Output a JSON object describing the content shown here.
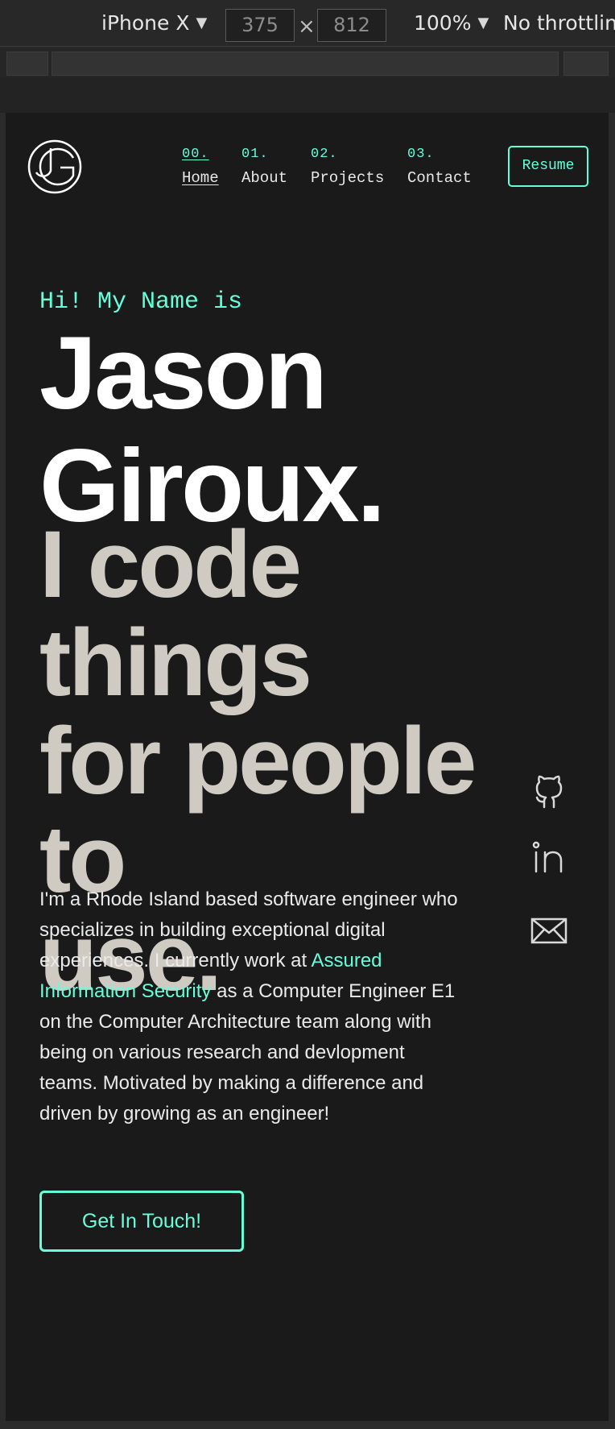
{
  "devtools": {
    "device": "iPhone X",
    "width": "375",
    "height": "812",
    "times": "×",
    "zoom": "100%",
    "throttling": "No throttling"
  },
  "header": {
    "nav": [
      {
        "num": "00.",
        "label": "Home"
      },
      {
        "num": "01.",
        "label": "About"
      },
      {
        "num": "02.",
        "label": "Projects"
      },
      {
        "num": "03.",
        "label": "Contact"
      }
    ],
    "resume": "Resume"
  },
  "hero": {
    "greeting": "Hi! My Name is",
    "name_line1": "Jason",
    "name_line2": "Giroux.",
    "tagline_line1": "I code things",
    "tagline_line2": "for people to",
    "tagline_line3": "use.",
    "bio_before": "I'm a Rhode Island based software engineer who specializes in building exceptional digital experiences. I currently work at ",
    "bio_link": "Assured Information Security",
    "bio_after": " as a Computer Engineer E1 on the Computer Architecture team along with being on various research and devlopment teams. Motivated by making a difference and driven by growing as an engineer!",
    "cta": "Get In Touch!"
  },
  "social": [
    "github-icon",
    "linkedin-icon",
    "mail-icon"
  ],
  "colors": {
    "accent": "#64ffda",
    "background": "#1a1a1a",
    "heading": "#ffffff",
    "tagline": "#cfcbc2"
  }
}
